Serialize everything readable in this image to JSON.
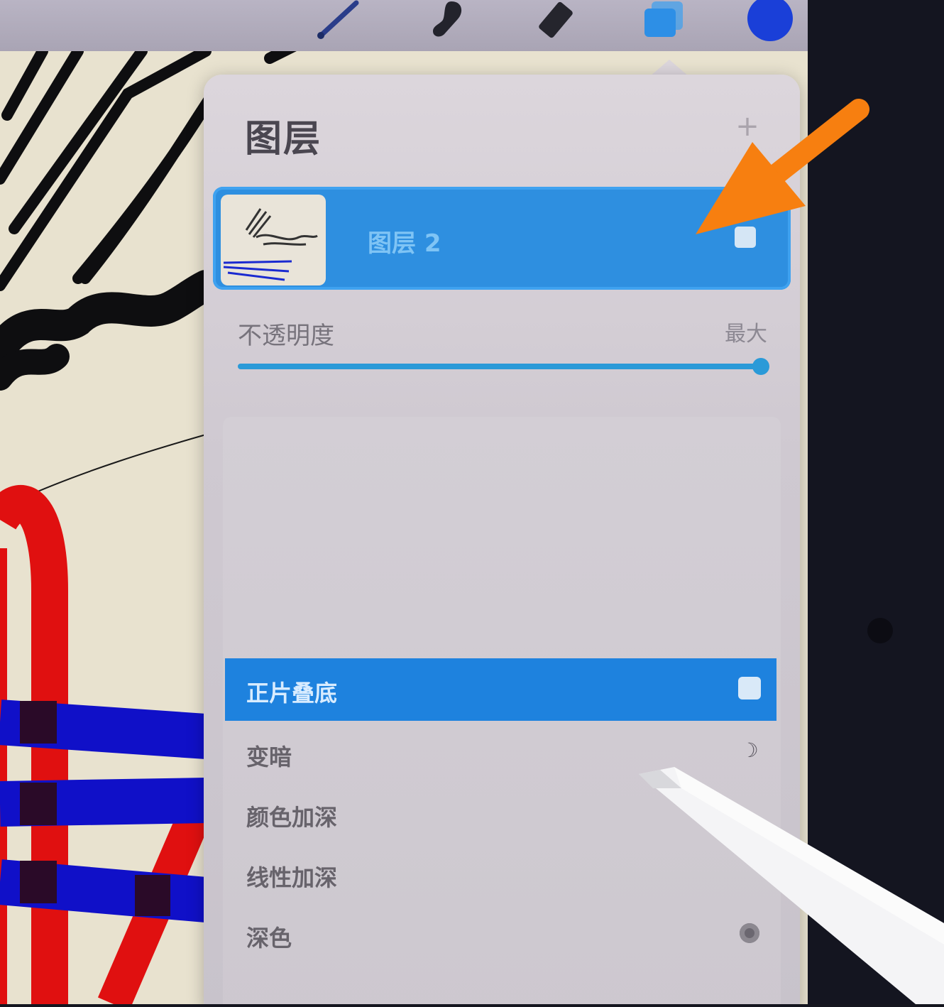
{
  "toolbar": {
    "tools": [
      "brush-icon",
      "smudge-icon",
      "eraser-icon",
      "layers-icon",
      "color-icon"
    ],
    "active_color": "#1a3fd8",
    "layers_icon_color": "#2d8fe6"
  },
  "layers_panel": {
    "title": "图层",
    "add_label": "+",
    "layers": [
      {
        "name": "图层 2",
        "visible": true,
        "selected": true
      }
    ],
    "opacity_label": "不透明度",
    "opacity_value": "最大",
    "opacity": 1.0,
    "blend_modes": [
      {
        "label": "正片叠底",
        "selected": true,
        "icon": "checkbox-icon"
      },
      {
        "label": "变暗",
        "selected": false,
        "icon": "moon-icon"
      },
      {
        "label": "颜色加深",
        "selected": false,
        "icon": ""
      },
      {
        "label": "线性加深",
        "selected": false,
        "icon": ""
      },
      {
        "label": "深色",
        "selected": false,
        "icon": "dot-icon"
      }
    ]
  },
  "colors": {
    "accent": "#2e8fe0",
    "annotation_arrow": "#f77f10"
  }
}
